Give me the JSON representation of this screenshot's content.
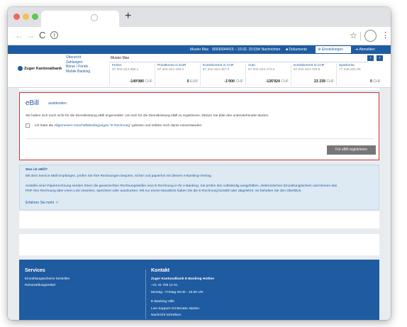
{
  "browser": {
    "tab_icon": "close-icon",
    "new_tab": "+",
    "reload": "C",
    "info": "i"
  },
  "topbar": {
    "user": "Muster Max",
    "session": "90930044415 – 10.02. 15:53",
    "messages": "Nachrichten",
    "documents": "Dokumente",
    "settings": "Einstellungen",
    "logout": "Abmelden"
  },
  "header": {
    "logo": "Zuger Kantonalbank",
    "nav": [
      "Übersicht",
      "Zahlungen",
      "Börse / Fonds",
      "Mobile Banking"
    ],
    "owner": "Muster Max",
    "accounts": [
      {
        "name": "Ferien",
        "number": "57.202.324.366.1",
        "balance": "-149'080",
        "currency": "CHF"
      },
      {
        "name": "Privatkonto in EUR",
        "number": "57.202.324.448.0",
        "balance": "0",
        "currency": "EUR"
      },
      {
        "name": "Kontokorrent in CHF",
        "number": "57.202.324.467.0",
        "balance": "-1'000",
        "currency": "CHF"
      },
      {
        "name": "Auto",
        "number": "57.202.324.473.0",
        "balance": "-126'924",
        "currency": "CHF"
      },
      {
        "name": "Kontokorrent in CHF",
        "number": "57.202.324.784.5",
        "balance": "23 239",
        "currency": "CHF"
      },
      {
        "name": "Sparkonto",
        "number": "77.346.341.06",
        "balance": "0",
        "currency": "CHF"
      }
    ]
  },
  "ebill": {
    "title": "eBill",
    "link": "ausblenden",
    "text": "Sie haben sich noch nicht für die Dienstleistung eBill angemeldet. Um sich für die Dienstleistung eBill zu registrieren, klicken Sie bitte den untenstehenden Button.",
    "agree_prefix": "Ich habe die ",
    "agree_link": "Allgemeinen Geschäftsbedingungen \"E-Rechnung\"",
    "agree_suffix": " gelesen und erkläre mich damit einverstanden.",
    "button": "Für eBill registrieren"
  },
  "info": {
    "title": "Was ist eBill?",
    "lead": "Mit dem Service eBill empfangen, prüfen Sie Ihre Rechnungen bequem, sicher und papierlos mit diesem e-Banking-Vertrag.",
    "body_1": "Anstelle einer Papierrechnung senden Ihnen die gewünschten Rechnungssteller eine E-Rechnung in Ihr e-Banking. Sie prüfen den vollständig ausgefüllten, elektronischen Einzahlungsschein und können das",
    "body_2": "PDF-Ihre Rechnung über einen Link einsehen, speichern oder ausdrucken. Mit nur einem Mausklick haben Sie die E-Rechnung bezahlt oder abgelehnt. So behalten Sie den Überblick.",
    "more": "Erfahren Sie mehr"
  },
  "footer": {
    "services_title": "Services",
    "services": [
      "Einzahlungsscheine bestellen",
      "Reisezahlungsmittel"
    ],
    "contact_title": "Kontakt",
    "hotline": "Zuger Kantonalbank E-Banking Hotline",
    "phone": "+41 41 709 12 61",
    "hours": "Montag - Freitag 08.00 - 18.00 Uhr",
    "help": "E-Banking Hilfe",
    "live": "Live-Support mit Berater starten",
    "write": "Nachricht schreiben"
  },
  "colors": {
    "brand": "#1f5ba0",
    "alert_border": "#c6373a",
    "button": "#767676",
    "info_bg": "#dde9f3"
  }
}
